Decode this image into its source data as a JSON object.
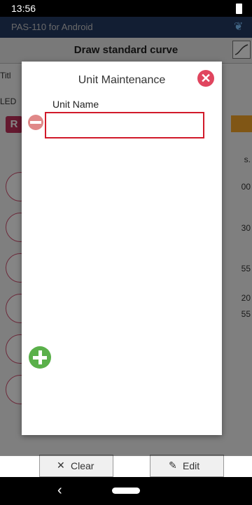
{
  "status": {
    "time": "13:56"
  },
  "app": {
    "name": "PAS-110 for Android"
  },
  "toolbar": {
    "title": "Draw standard curve"
  },
  "background": {
    "title_label": "Titl",
    "led_label": "LED",
    "r_button": "R",
    "s_label": "s.",
    "right_values": [
      "00",
      "30",
      "55",
      "20",
      "55"
    ]
  },
  "dialog": {
    "title": "Unit Maintenance",
    "unit_name_label": "Unit Name",
    "unit_name_value": ""
  },
  "footer": {
    "clear_label": "Clear",
    "edit_label": "Edit"
  },
  "nav": {
    "back": "‹"
  }
}
